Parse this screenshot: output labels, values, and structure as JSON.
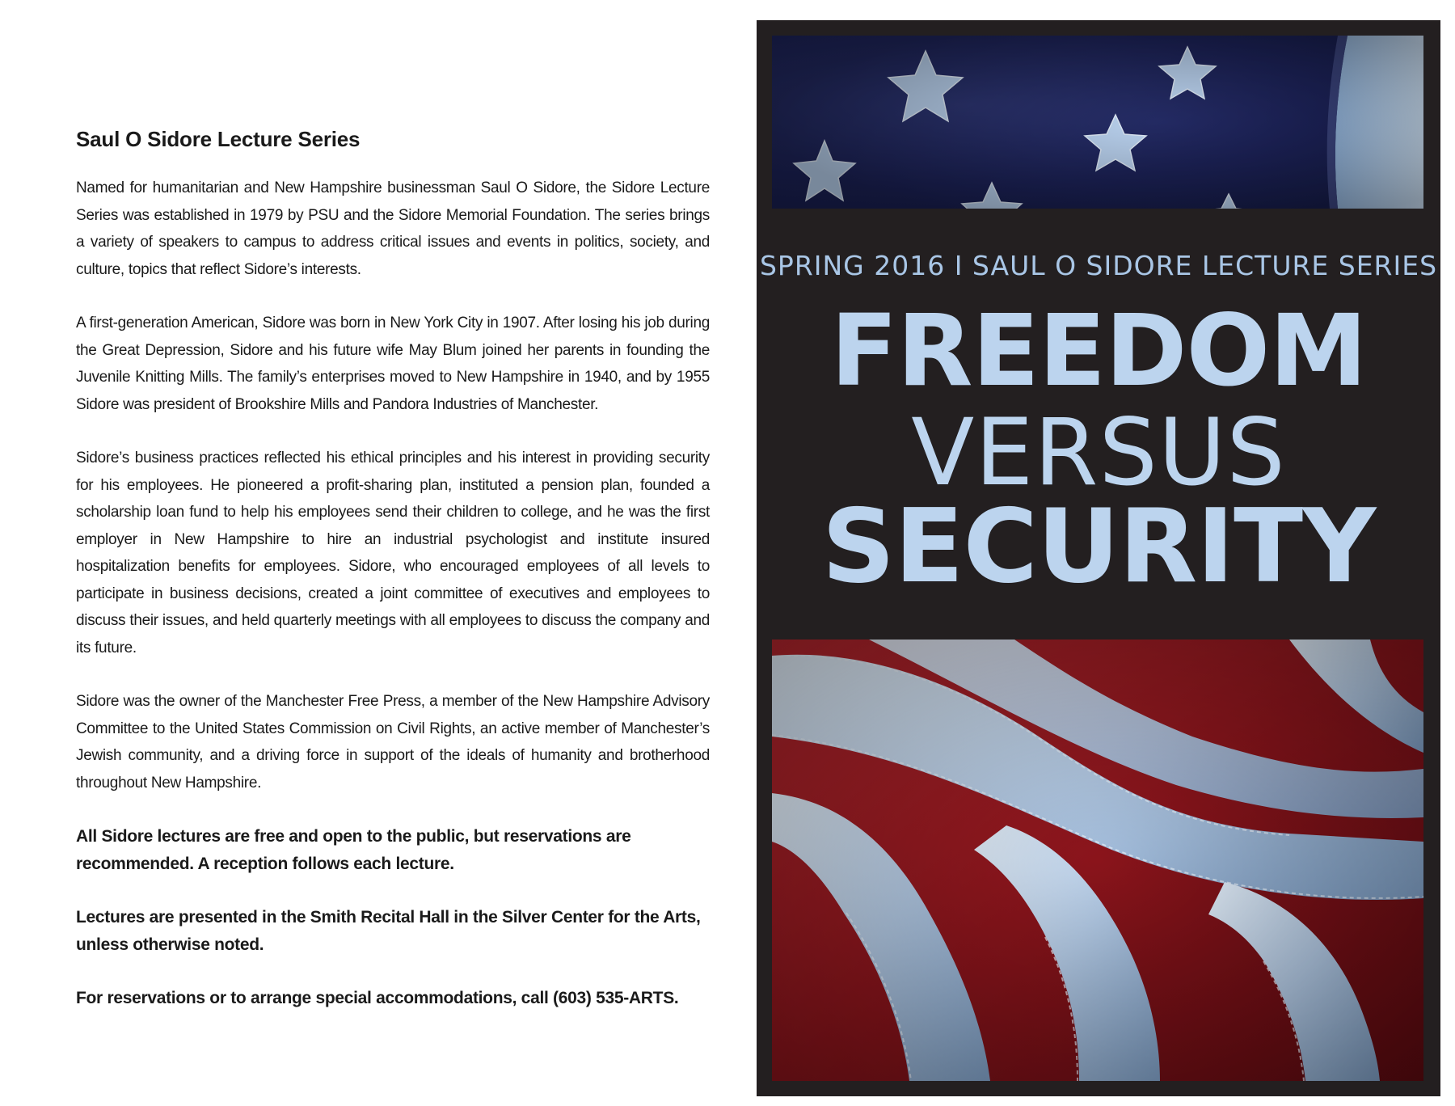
{
  "left": {
    "heading": "Saul O Sidore Lecture Series",
    "paragraphs": [
      "Named for humanitarian and New Hampshire businessman Saul O Sidore, the Sidore Lecture Series was established in 1979 by PSU and the Sidore Memorial Foundation. The series brings a variety of speakers to campus to address critical issues and events in politics, society, and culture, topics that reflect Sidore’s interests.",
      "A first-generation American, Sidore was born in New York City in 1907. After losing his job during the Great Depression, Sidore and his future wife May Blum joined her parents in founding the Juvenile Knitting Mills. The family’s enterprises moved to New Hampshire in 1940, and by 1955 Sidore was president of Brookshire Mills and Pandora Industries of Manchester.",
      "Sidore’s business practices reflected his ethical principles and his interest in providing security for his employees. He pioneered a profit-sharing plan, instituted a pension plan, founded a scholarship loan fund to help his employees send their children to college, and he was the first employer in New Hampshire to hire an industrial psychologist and institute insured hospitalization benefits for employees. Sidore, who encouraged employees of all levels to participate in business decisions, created a joint committee of executives and employees to discuss their issues, and held quarterly meetings with all employees to discuss the company and its future.",
      "Sidore was the owner of the Manchester Free Press, a member of the New Hampshire Advisory Committee to the United States Commission on Civil Rights, an active member of Manchester’s Jewish community, and a driving force in support of the ideals of humanity and brotherhood throughout New Hampshire."
    ],
    "notes": [
      "All Sidore lectures are free and open to the public, but reservations are recommended. A reception follows each lecture.",
      "Lectures are presented in the Smith Recital Hall in the Silver Center for the Arts, unless otherwise noted.",
      "For reservations or to arrange special accommodations, call (603) 535-ARTS."
    ]
  },
  "cover": {
    "subtitle": "SPRING 2016  I  SAUL O SIDORE LECTURE SERIES",
    "title_line1": "FREEDOM",
    "title_line2": "VERSUS",
    "title_line3": "SECURITY"
  },
  "colors": {
    "cover_bg": "#231f20",
    "title_text": "#bcd4ee",
    "flag_blue": "#1c2258",
    "flag_red": "#9b1b22",
    "flag_white": "#c9dbef"
  }
}
